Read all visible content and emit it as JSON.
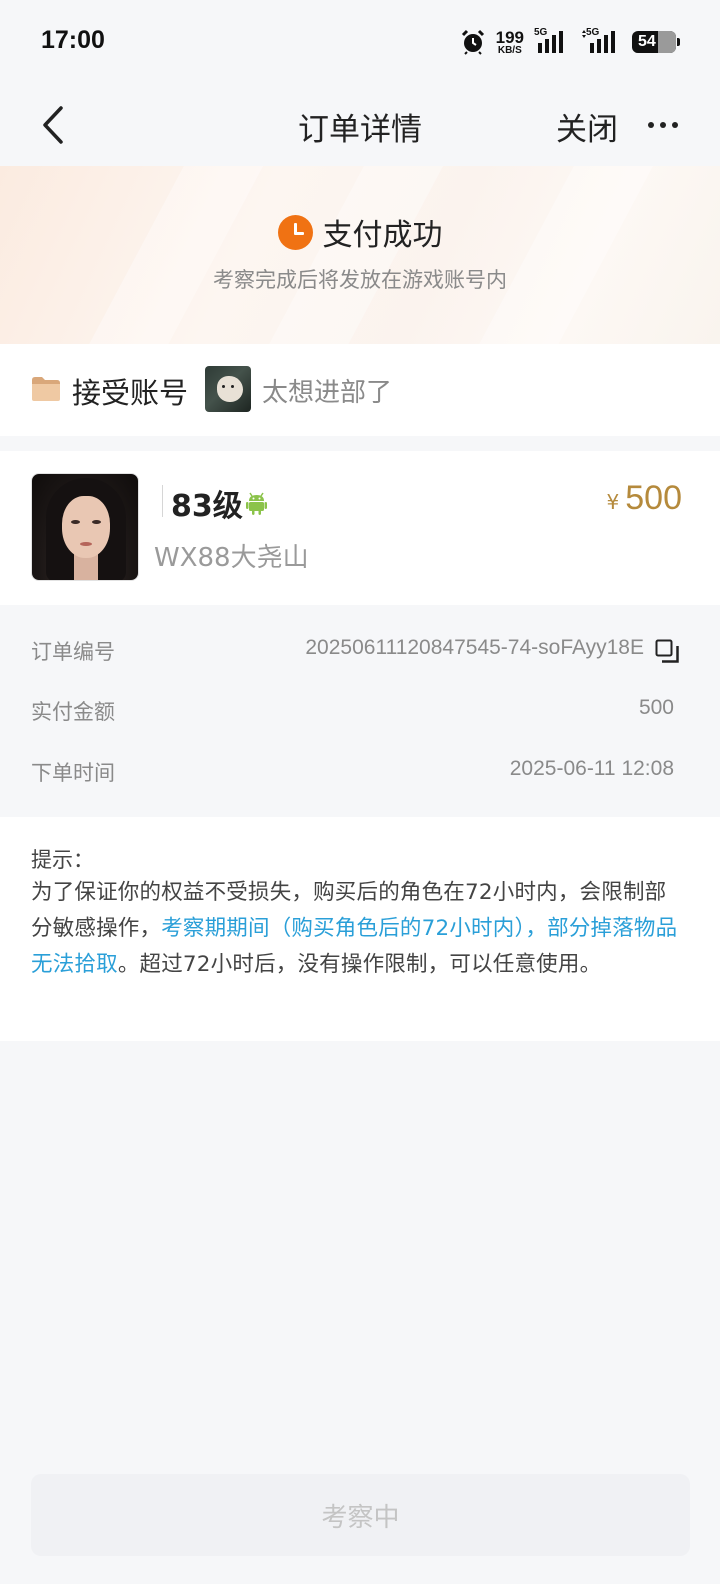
{
  "status_bar": {
    "time": "17:00",
    "net_speed_value": "199",
    "net_speed_unit": "KB/S",
    "sim1_label": "5G",
    "sim2_label": "5G",
    "battery": "54",
    "icons": [
      "alarm-icon",
      "signal-icon",
      "signal-icon",
      "battery-icon"
    ]
  },
  "nav": {
    "title": "订单详情",
    "close_label": "关闭",
    "icons": [
      "back-arrow-icon",
      "more-icon"
    ]
  },
  "banner": {
    "status": "支付成功",
    "subtitle": "考察完成后将发放在游戏账号内",
    "icon": "clock-icon",
    "accent_color": "#f07213"
  },
  "account": {
    "label": "接受账号",
    "name": "太想进部了",
    "icon": "folder-icon"
  },
  "product": {
    "level": "83级",
    "platform_icon": "android-icon",
    "server_name": "WX88大尧山",
    "currency_symbol": "¥",
    "price": "500",
    "price_color": "#b58a3c"
  },
  "order_info": [
    {
      "key": "订单编号",
      "value": "20250611120847545-74-soFAyy18E",
      "copyable": true
    },
    {
      "key": "实付金额",
      "value": "500"
    },
    {
      "key": "下单时间",
      "value": "2025-06-11 12:08"
    }
  ],
  "tip": {
    "title": "提示：",
    "text_before": "为了保证你的权益不受损失，购买后的角色在72小时内，会限制部分敏感操作，",
    "highlight": "考察期期间（购买角色后的72小时内），部分掉落物品无法拾取",
    "text_after": "。超过72小时后，没有操作限制，可以任意使用。",
    "highlight_color": "#2a9fd8"
  },
  "bottom": {
    "button_label": "考察中"
  }
}
